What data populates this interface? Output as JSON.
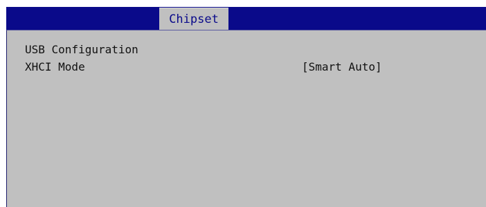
{
  "tabs": [
    {
      "label": "Chipset",
      "active": true
    }
  ],
  "colors": {
    "header_background": "#0a0a8a",
    "panel_background": "#c0c0c0",
    "tab_text": "#0a0a8a",
    "body_text": "#111111"
  },
  "content": {
    "section_title": "USB Configuration",
    "items": [
      {
        "label": "XHCI Mode",
        "value": "[Smart Auto]"
      }
    ]
  }
}
